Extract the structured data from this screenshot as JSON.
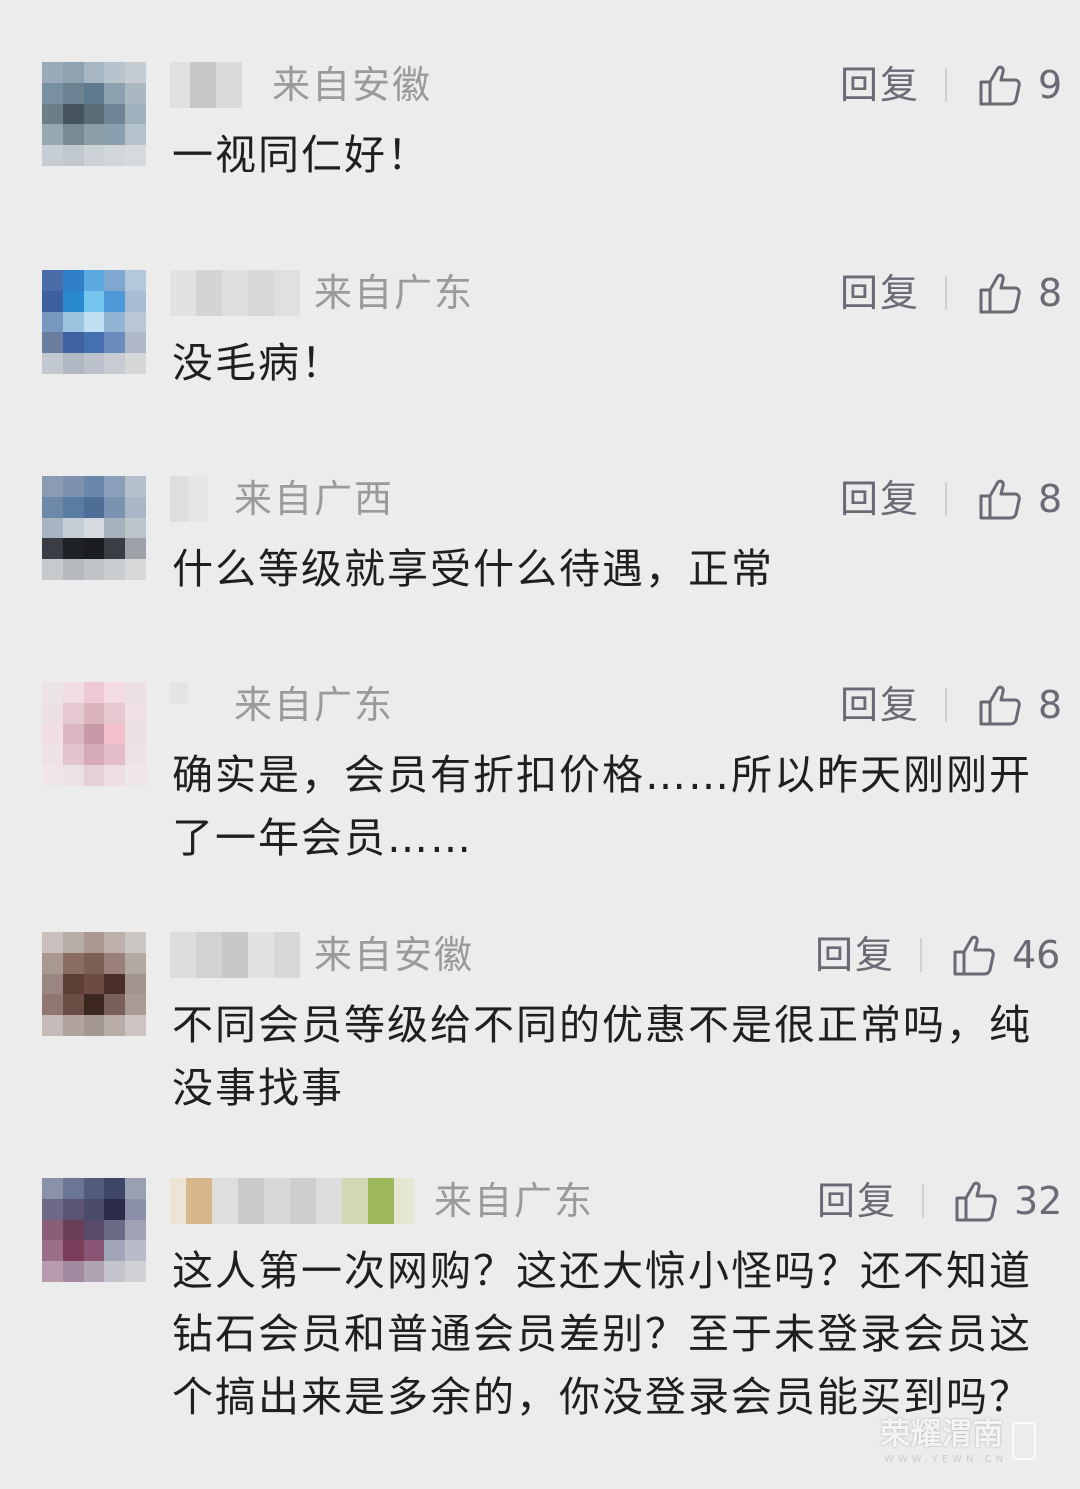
{
  "colors": {
    "background": "#ececec",
    "text_primary": "#1f1f1f",
    "location_text": "#9a9a9a",
    "action_text": "#6a6a75"
  },
  "icons": {
    "like": "thumbs-up-outline-icon"
  },
  "comments": [
    {
      "location": "来自安徽",
      "reply_label": "回复",
      "likes": "9",
      "text": "一视同仁好！"
    },
    {
      "location": "来自广东",
      "reply_label": "回复",
      "likes": "8",
      "text": "没毛病！"
    },
    {
      "location": "来自广西",
      "reply_label": "回复",
      "likes": "8",
      "text": "什么等级就享受什么待遇，正常"
    },
    {
      "location": "来自广东",
      "reply_label": "回复",
      "likes": "8",
      "text": "确实是，会员有折扣价格……所以昨天刚刚开了一年会员……"
    },
    {
      "location": "来自安徽",
      "reply_label": "回复",
      "likes": "46",
      "text": "不同会员等级给不同的优惠不是很正常吗，纯没事找事"
    },
    {
      "location": "来自广东",
      "reply_label": "回复",
      "likes": "32",
      "text": "这人第一次网购？这还大惊小怪吗？还不知道钻石会员和普通会员差别？至于未登录会员这个搞出来是多余的，你没登录会员能买到吗？"
    }
  ],
  "watermark": {
    "main": "荣耀渭南",
    "sub": "WWW.YEWN.CN"
  }
}
